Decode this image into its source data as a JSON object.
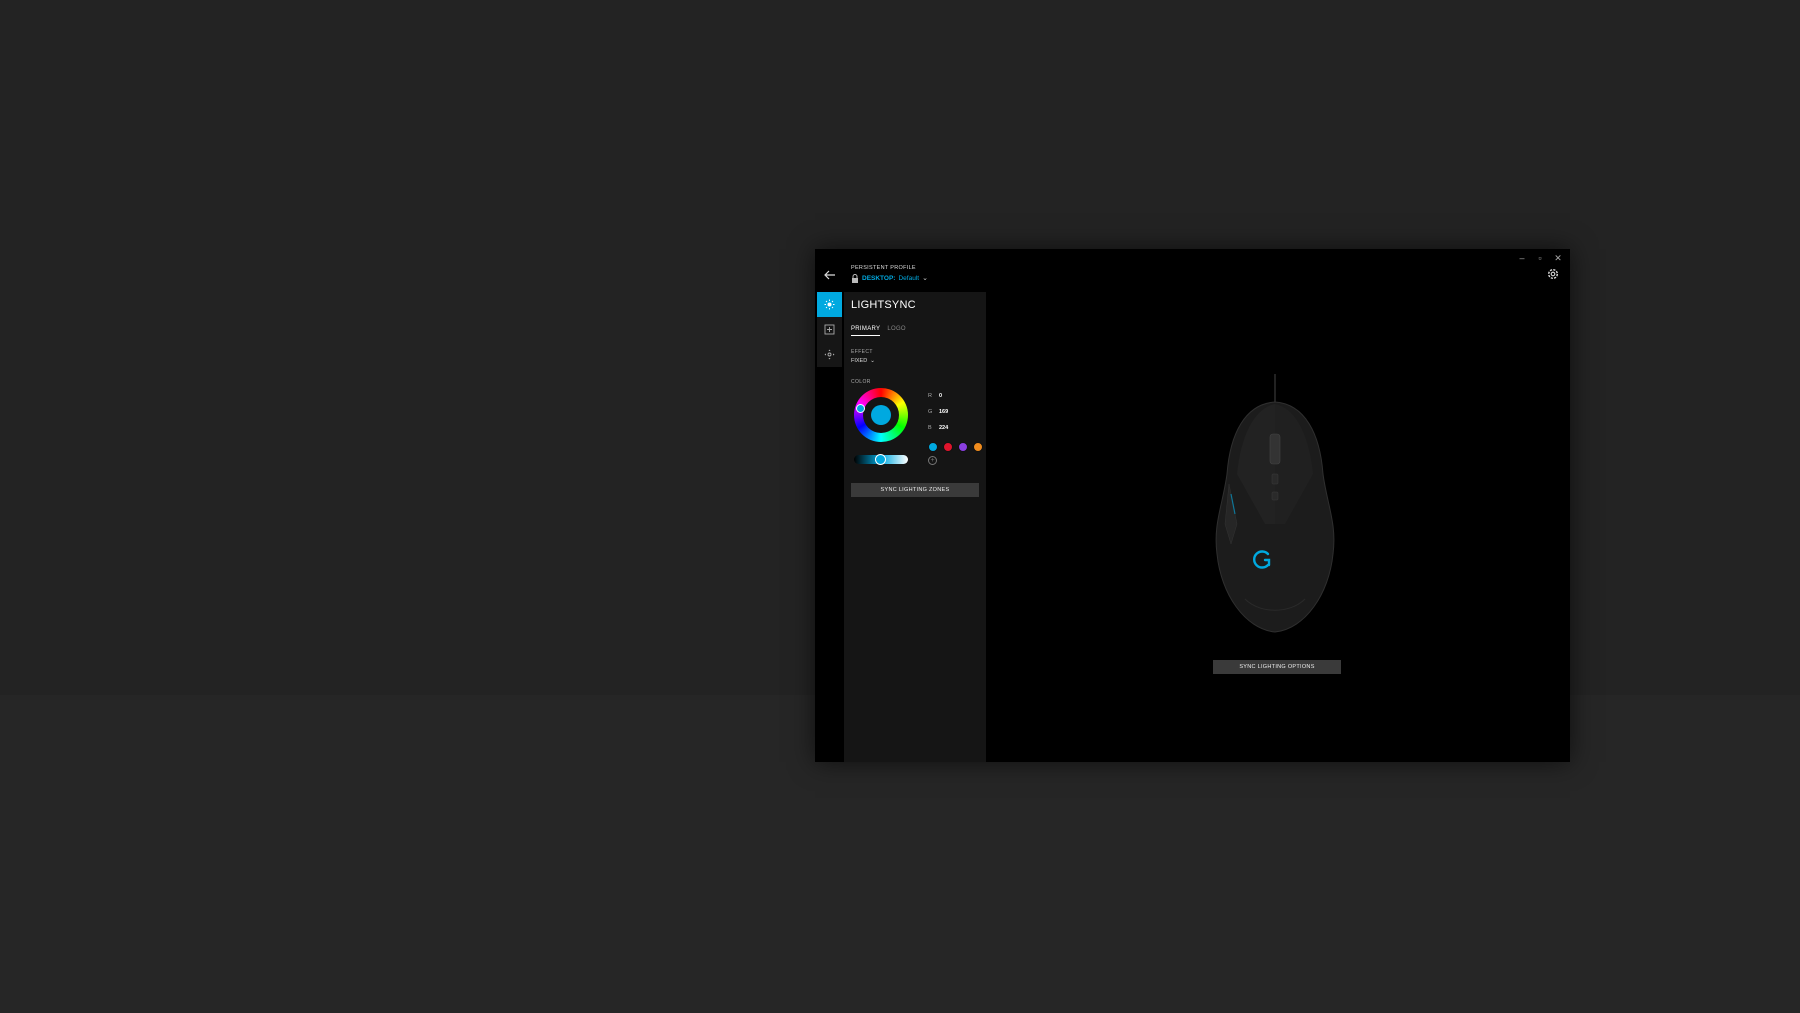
{
  "window": {
    "controls": {
      "minimize": "–",
      "maximize": "▫",
      "close": "✕"
    }
  },
  "header": {
    "back_icon": "arrow-left-icon",
    "profile_label": "PERSISTENT PROFILE",
    "profile_prefix": "DESKTOP:",
    "profile_name": "Default",
    "settings_icon": "gear-icon"
  },
  "rail": {
    "items": [
      {
        "icon": "lightsync-icon",
        "active": true
      },
      {
        "icon": "assignments-icon",
        "active": false
      },
      {
        "icon": "sensitivity-icon",
        "active": false
      }
    ]
  },
  "panel": {
    "title": "LIGHTSYNC",
    "tabs": [
      {
        "label": "PRIMARY",
        "active": true
      },
      {
        "label": "LOGO",
        "active": false
      }
    ],
    "effect_label": "EFFECT",
    "effect_value": "FIXED",
    "color_label": "COLOR",
    "rgb": {
      "r_label": "R",
      "r": "0",
      "g_label": "G",
      "g": "169",
      "b_label": "B",
      "b": "224"
    },
    "current_color": "#00a9e0",
    "presets": [
      "#00a9e0",
      "#e0142c",
      "#8a3fe0",
      "#f08c1e"
    ],
    "sync_zones_label": "SYNC LIGHTING ZONES"
  },
  "main": {
    "sync_options_label": "SYNC LIGHTING OPTIONS",
    "device_logo_color": "#00a9e0"
  }
}
